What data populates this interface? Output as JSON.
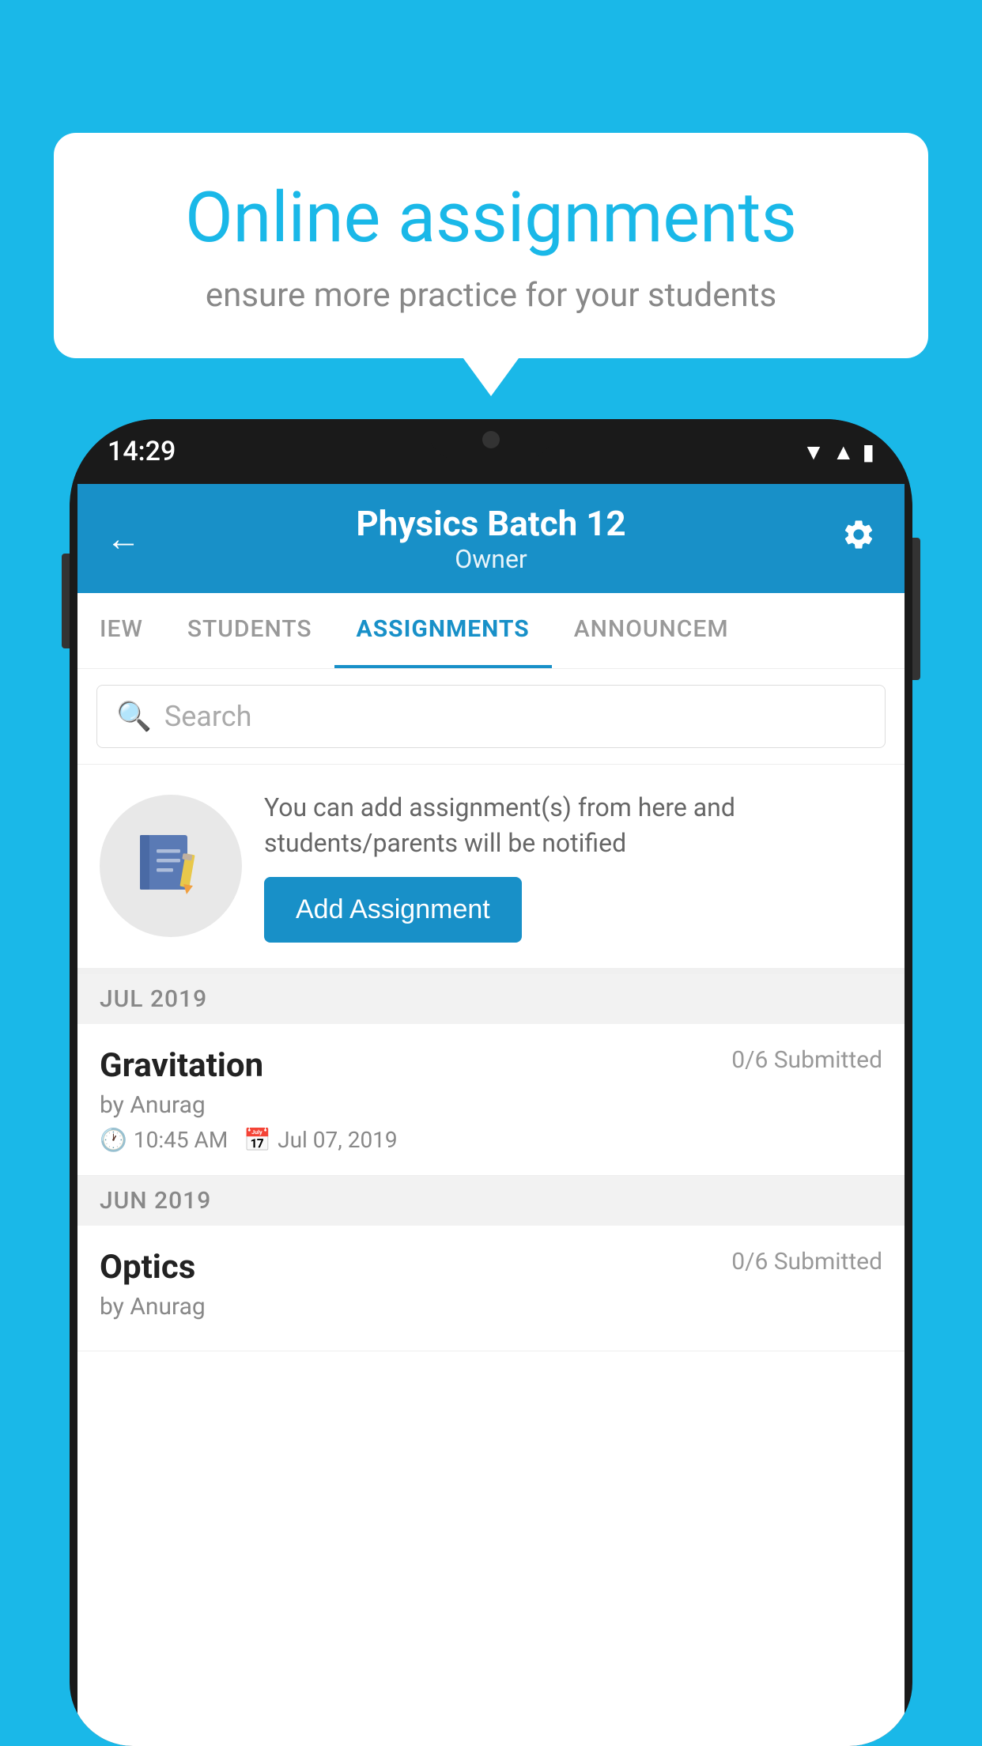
{
  "background_color": "#1ab8e8",
  "speech_bubble": {
    "title": "Online assignments",
    "subtitle": "ensure more practice for your students"
  },
  "phone": {
    "status_bar": {
      "time": "14:29"
    },
    "header": {
      "title": "Physics Batch 12",
      "subtitle": "Owner",
      "back_label": "←",
      "gear_label": "⚙"
    },
    "tabs": [
      {
        "label": "IEW",
        "active": false
      },
      {
        "label": "STUDENTS",
        "active": false
      },
      {
        "label": "ASSIGNMENTS",
        "active": true
      },
      {
        "label": "ANNOUNCEM",
        "active": false
      }
    ],
    "search": {
      "placeholder": "Search"
    },
    "add_assignment_section": {
      "description": "You can add assignment(s) from here and students/parents will be notified",
      "button_label": "Add Assignment"
    },
    "month_sections": [
      {
        "month_label": "JUL 2019",
        "assignments": [
          {
            "name": "Gravitation",
            "submitted": "0/6 Submitted",
            "by": "by Anurag",
            "time": "10:45 AM",
            "date": "Jul 07, 2019"
          }
        ]
      },
      {
        "month_label": "JUN 2019",
        "assignments": [
          {
            "name": "Optics",
            "submitted": "0/6 Submitted",
            "by": "by Anurag",
            "time": "",
            "date": ""
          }
        ]
      }
    ]
  }
}
